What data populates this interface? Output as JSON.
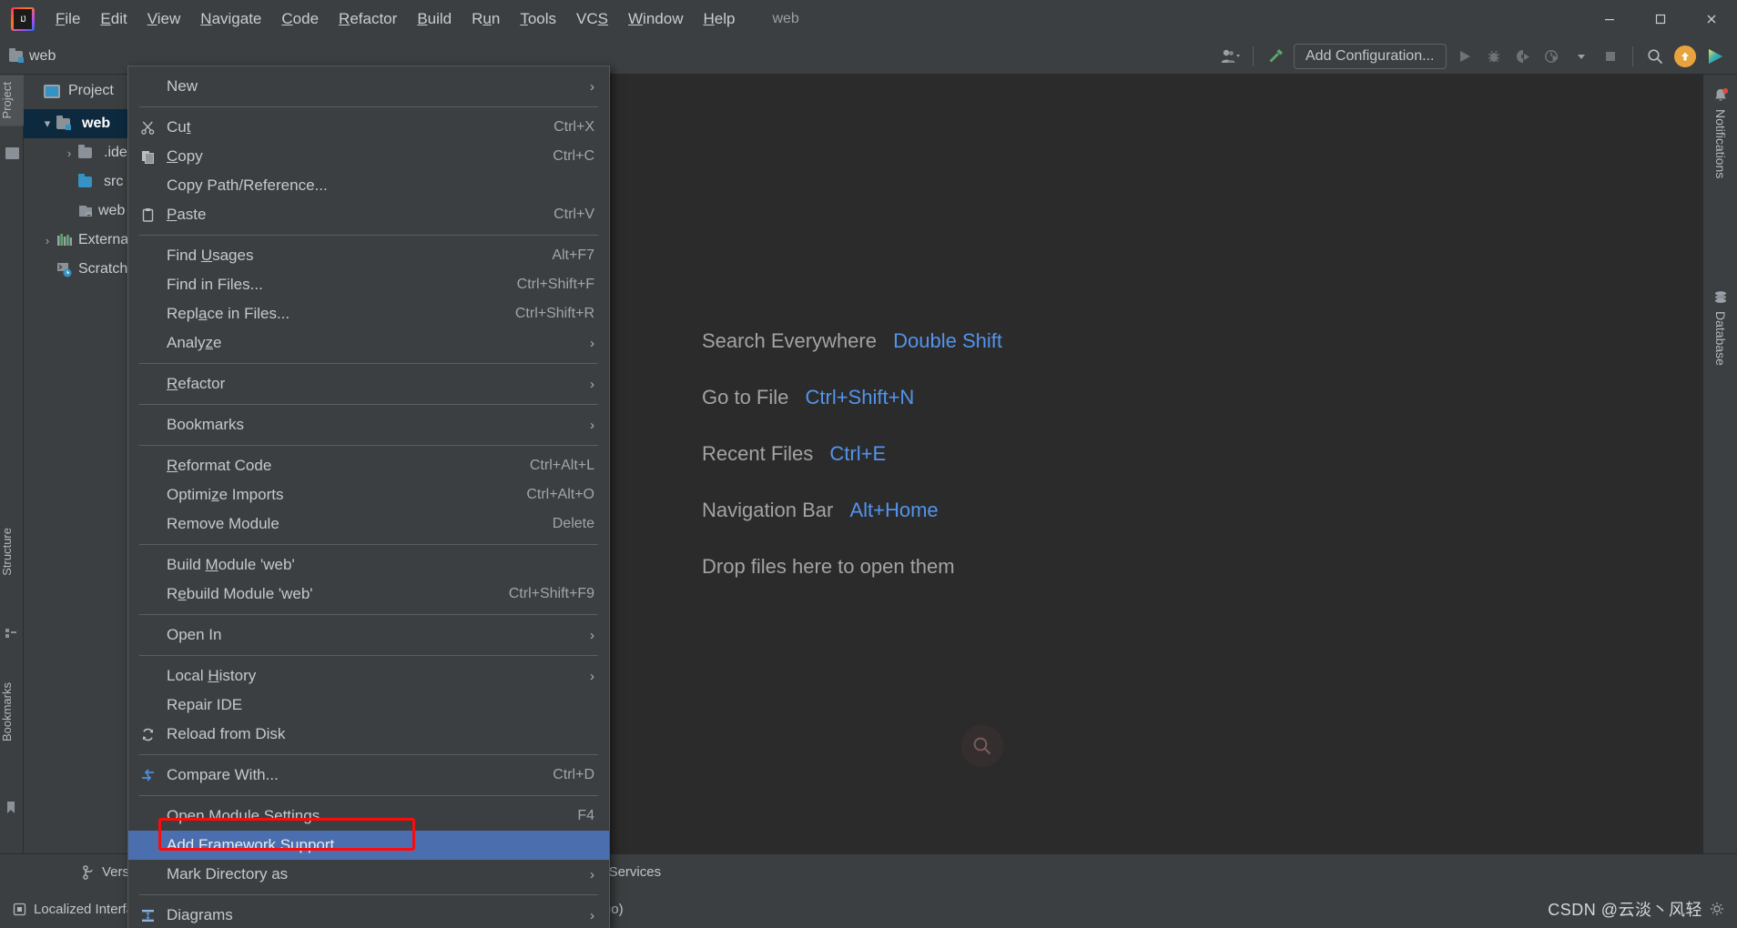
{
  "window": {
    "app_icon": "intellij-idea-logo",
    "title": "web",
    "minimize": "–",
    "maximize": "□",
    "close": "✕"
  },
  "menubar": {
    "items": [
      {
        "label": "File",
        "mnemonic": "F"
      },
      {
        "label": "Edit",
        "mnemonic": "E"
      },
      {
        "label": "View",
        "mnemonic": "V"
      },
      {
        "label": "Navigate",
        "mnemonic": "N"
      },
      {
        "label": "Code",
        "mnemonic": "C"
      },
      {
        "label": "Refactor",
        "mnemonic": "R"
      },
      {
        "label": "Build",
        "mnemonic": "B"
      },
      {
        "label": "Run",
        "mnemonic": "u"
      },
      {
        "label": "Tools",
        "mnemonic": "T"
      },
      {
        "label": "VCS",
        "mnemonic": "S"
      },
      {
        "label": "Window",
        "mnemonic": "W"
      },
      {
        "label": "Help",
        "mnemonic": "H"
      }
    ]
  },
  "toolbar": {
    "breadcrumb": "web",
    "add_configuration": "Add Configuration...",
    "icons": [
      "user-avatar-icon",
      "chevron-down-icon",
      "hammer-build-icon",
      "run-icon",
      "debug-icon",
      "run-with-coverage-icon",
      "profiler-icon",
      "chevron-down-icon",
      "stop-icon",
      "search-icon",
      "update-arrow-icon",
      "ide-feature-icon"
    ]
  },
  "left_strip": {
    "project_label": "Project",
    "structure_label": "Structure",
    "bookmarks_label": "Bookmarks"
  },
  "project_panel": {
    "header": "Project",
    "tree": [
      {
        "label": "web",
        "icon": "module-folder-icon",
        "indent": 0,
        "arrow": "▾",
        "selected": true
      },
      {
        "label": ".idea",
        "icon": "folder-icon",
        "indent": 1,
        "arrow": "›",
        "selected": false
      },
      {
        "label": "src",
        "icon": "source-folder-icon",
        "indent": 1,
        "arrow": "",
        "selected": false
      },
      {
        "label": "web",
        "icon": "web-folder-icon",
        "indent": 1,
        "arrow": "",
        "selected": false
      },
      {
        "label": "External Libraries",
        "icon": "libraries-icon",
        "indent": 0,
        "arrow": "›",
        "selected": false
      },
      {
        "label": "Scratches and Consoles",
        "icon": "scratches-icon",
        "indent": 0,
        "arrow": "",
        "selected": false
      }
    ]
  },
  "context_menu": {
    "sections": [
      {
        "items": [
          {
            "label": "New",
            "mnemonic": "",
            "icon": "",
            "shortcut": "",
            "submenu": true
          }
        ]
      },
      {
        "items": [
          {
            "label": "Cut",
            "mnemonic": "t",
            "icon": "scissors-icon",
            "shortcut": "Ctrl+X",
            "submenu": false
          },
          {
            "label": "Copy",
            "mnemonic": "C",
            "icon": "copy-icon",
            "shortcut": "Ctrl+C",
            "submenu": false
          },
          {
            "label": "Copy Path/Reference...",
            "mnemonic": "",
            "icon": "",
            "shortcut": "",
            "submenu": false
          },
          {
            "label": "Paste",
            "mnemonic": "P",
            "icon": "clipboard-icon",
            "shortcut": "Ctrl+V",
            "submenu": false
          }
        ]
      },
      {
        "items": [
          {
            "label": "Find Usages",
            "mnemonic": "U",
            "icon": "",
            "shortcut": "Alt+F7",
            "submenu": false
          },
          {
            "label": "Find in Files...",
            "mnemonic": "",
            "icon": "",
            "shortcut": "Ctrl+Shift+F",
            "submenu": false
          },
          {
            "label": "Replace in Files...",
            "mnemonic": "a",
            "icon": "",
            "shortcut": "Ctrl+Shift+R",
            "submenu": false
          },
          {
            "label": "Analyze",
            "mnemonic": "z",
            "icon": "",
            "shortcut": "",
            "submenu": true
          }
        ]
      },
      {
        "items": [
          {
            "label": "Refactor",
            "mnemonic": "R",
            "icon": "",
            "shortcut": "",
            "submenu": true
          }
        ]
      },
      {
        "items": [
          {
            "label": "Bookmarks",
            "mnemonic": "",
            "icon": "",
            "shortcut": "",
            "submenu": true
          }
        ]
      },
      {
        "items": [
          {
            "label": "Reformat Code",
            "mnemonic": "R",
            "icon": "",
            "shortcut": "Ctrl+Alt+L",
            "submenu": false
          },
          {
            "label": "Optimize Imports",
            "mnemonic": "z",
            "icon": "",
            "shortcut": "Ctrl+Alt+O",
            "submenu": false
          },
          {
            "label": "Remove Module",
            "mnemonic": "",
            "icon": "",
            "shortcut": "Delete",
            "submenu": false
          }
        ]
      },
      {
        "items": [
          {
            "label": "Build Module 'web'",
            "mnemonic": "M",
            "icon": "",
            "shortcut": "",
            "submenu": false
          },
          {
            "label": "Rebuild Module 'web'",
            "mnemonic": "e",
            "icon": "",
            "shortcut": "Ctrl+Shift+F9",
            "submenu": false
          }
        ]
      },
      {
        "items": [
          {
            "label": "Open In",
            "mnemonic": "",
            "icon": "",
            "shortcut": "",
            "submenu": true
          }
        ]
      },
      {
        "items": [
          {
            "label": "Local History",
            "mnemonic": "H",
            "icon": "",
            "shortcut": "",
            "submenu": true
          },
          {
            "label": "Repair IDE",
            "mnemonic": "",
            "icon": "",
            "shortcut": "",
            "submenu": false
          },
          {
            "label": "Reload from Disk",
            "mnemonic": "",
            "icon": "reload-icon",
            "shortcut": "",
            "submenu": false
          }
        ]
      },
      {
        "items": [
          {
            "label": "Compare With...",
            "mnemonic": "",
            "icon": "compare-icon",
            "shortcut": "Ctrl+D",
            "submenu": false
          }
        ]
      },
      {
        "items": [
          {
            "label": "Open Module Settings",
            "mnemonic": "",
            "icon": "",
            "shortcut": "F4",
            "submenu": false
          },
          {
            "label": "Add Framework Support...",
            "mnemonic": "",
            "icon": "",
            "shortcut": "",
            "submenu": false,
            "highlighted": true
          },
          {
            "label": "Mark Directory as",
            "mnemonic": "",
            "icon": "",
            "shortcut": "",
            "submenu": true
          }
        ]
      },
      {
        "items": [
          {
            "label": "Diagrams",
            "mnemonic": "",
            "icon": "diagrams-icon",
            "shortcut": "",
            "submenu": true
          }
        ]
      }
    ]
  },
  "editor": {
    "welcome_rows": [
      {
        "action": "Search Everywhere",
        "shortcut": "Double Shift"
      },
      {
        "action": "Go to File",
        "shortcut": "Ctrl+Shift+N"
      },
      {
        "action": "Recent Files",
        "shortcut": "Ctrl+E"
      },
      {
        "action": "Navigation Bar",
        "shortcut": "Alt+Home"
      },
      {
        "action": "Drop files here to open them",
        "shortcut": ""
      }
    ]
  },
  "right_strip": {
    "items": [
      {
        "label": "Notifications",
        "icon": "bell-icon",
        "badge": true
      },
      {
        "label": "Database",
        "icon": "database-icon",
        "badge": false
      }
    ]
  },
  "bottom_bar": {
    "version_control": "Version Control",
    "services": "Services"
  },
  "status_bar": {
    "localized_text": "Localized Interface",
    "build_text": "(te ago)",
    "watermark": "CSDN @云淡丶风轻"
  },
  "colors": {
    "menu_highlight": "#4b6eaf",
    "annotation_red": "#fb0b0b",
    "key_blue": "#5394ec",
    "accent_orange": "#e8a33d",
    "tree_selected": "#0d293e"
  }
}
